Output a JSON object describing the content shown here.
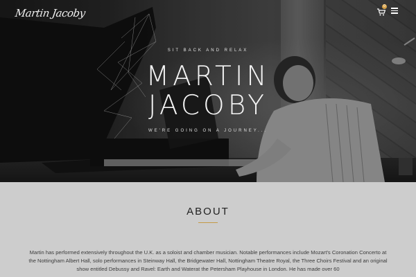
{
  "header": {
    "logo_text": "Martin Jacoby",
    "cart_count": "0",
    "icons": [
      "cart-icon",
      "menu-icon"
    ]
  },
  "hero": {
    "tagline_top": "SIT BACK AND RELAX",
    "title_line1": "MARTIN",
    "title_line2": "JACOBY",
    "tagline_bottom": "WE'RE GOING ON A JOURNEY..."
  },
  "about": {
    "title": "ABOUT",
    "accent_color": "#c49a45",
    "text": "Martin has performed extensively throughout the U.K. as a soloist and chamber musician. Notable performances include Mozart's Coronation Concerto at the Nottingham Albert Hall, solo performances in Steinway Hall, the Bridgewater Hall, Nottingham Theatre Royal, the Three Choirs Festival and an original show entitled Debussy and Ravel: Earth and Waterat the Petersham Playhouse in London. He has made over 60"
  }
}
